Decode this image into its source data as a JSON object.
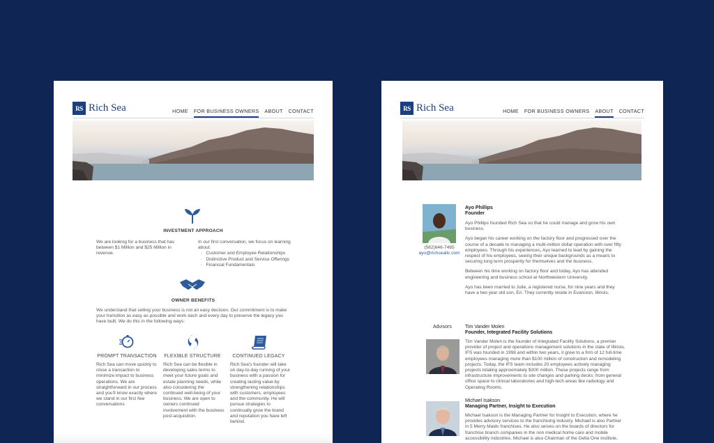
{
  "brand": {
    "logo_mark": "RS",
    "name": "Rich Sea"
  },
  "nav_items": [
    "HOME",
    "FOR BUSINESS OWNERS",
    "ABOUT",
    "CONTACT"
  ],
  "left_page": {
    "active_nav": "FOR BUSINESS OWNERS",
    "investment": {
      "heading": "INVESTMENT APPROACH",
      "left_text": "We are looking for a business that has between $1 Million and $25 Million in revenue.",
      "right_intro": "In our first conversation, we focus on learning about:",
      "bullets": [
        "Customer and Employee Relationships",
        "Distinctive Product and Service Offerings",
        "Financial Fundamentals"
      ]
    },
    "owner_benefits": {
      "heading": "OWNER BENEFITS",
      "text": "We understand that selling your business is not an easy decision. Our commitment is to make your transition as easy as possible and work each and every day to preserve the legacy you have built. We do this in the following ways:"
    },
    "columns": [
      {
        "icon": "stopwatch-icon",
        "title": "PROMPT TRANSACTION",
        "text": "Rich Sea can move quickly to close a transaction to minimize impact to business operations. We are straightforward in our process and you'll know exactly where we stand in our first few conversations"
      },
      {
        "icon": "flex-icon",
        "title": "FLEXIBLE STRUCTURE",
        "text": "Rich Sea can be flexible in developing sales terms to meet your future goals and estate planning needs, while also considering the continued well-being of your business. We are open to owners continued involvement with the business post-acquisition."
      },
      {
        "icon": "scroll-icon",
        "title": "CONTINUED LEGACY",
        "text": "Rich Sea's founder will take on day-to-day running of your business with a passion for creating lasting value by strengthening relationships with customers, employees and the community.  He will pursue strategies to continually grow the brand and reputation you have left behind."
      }
    ]
  },
  "right_page": {
    "active_nav": "ABOUT",
    "founder": {
      "name": "Ayo Phillips",
      "role": "Founder",
      "phone": "(562)646-7485",
      "email": "ayo@richseallc.com",
      "paragraphs": [
        "Ayo Phillips founded Rich Sea so that he could manage and grow his own business.",
        "Ayo began his career working on the factory floor and progressed over the course of a decade to managing a multi-million dollar operation with over fifty employees. Through his experiences, Ayo learned to lead by gaining the respect of his employees, seeing their unique backgrounds as a means to securing long term prosperity for themselves and the business.",
        "Between his time working on factory floor and today, Ayo has attended engineering and business school at Northwestern University.",
        "Ayo has been married to Julie, a registered nurse, for nine years and they have a two year old son, Eri. They currently reside in Evanston, Illinois."
      ]
    },
    "advisors_label": "Advisors",
    "advisors": [
      {
        "name": "Tim Vander Molen",
        "role": "Founder, Integrated Facility Solutions",
        "text": "Tim Vander Molen is the founder of Integrated Facility Solutions, a premier provider of project and operations management solutions in the state of Illinois. IFS was founded in 1998 and within two years, it grew to a firm of 12 full-time employees managing more than $100 million of construction and remodeling projects. Today, the IFS team includes 20 employees actively managing projects totaling approximately $300 million. These projects range from infrastructure improvements to site changes and parking decks; from general office space to clinical laboratories and high-tech areas like radiology and Operating Rooms."
      },
      {
        "name": "Michael Isakson",
        "role": "Managing Partner, Insight to Execution",
        "text": "Michael Isakson is the Managing Partner for Insight to Execution, where he provides advisory services to the franchising industry. Michael is also Partner in 5 Merry Maids franchises. He also serves on the boards of directors for franchise branch companies in the non medical home care and mobile accessibility industries. Michael is also Chairman of the Delta One institute,"
      }
    ]
  },
  "colors": {
    "background": "#0f2554",
    "brand": "#1a3f7e",
    "accent": "#2d5b9c"
  }
}
